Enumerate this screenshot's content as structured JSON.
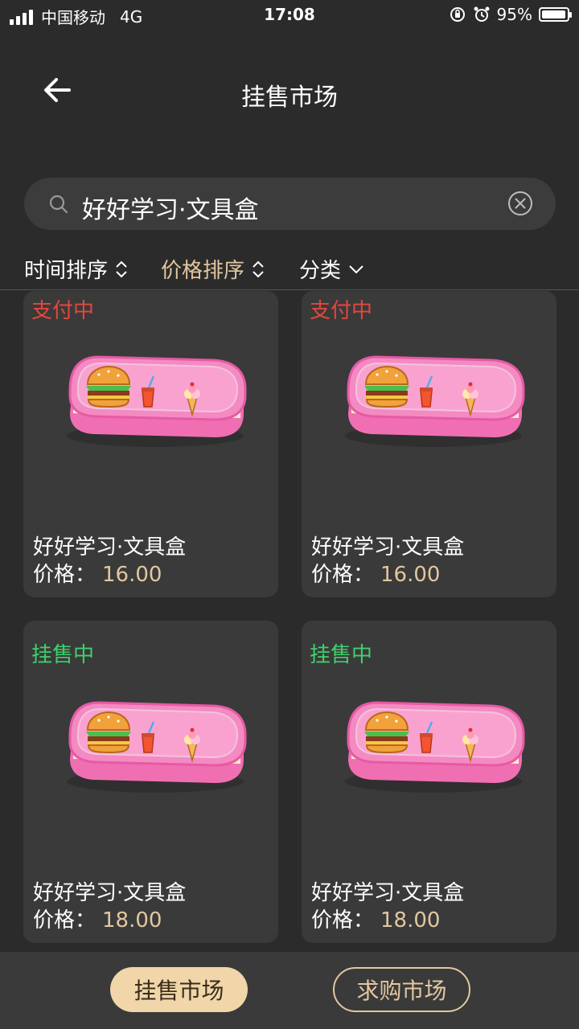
{
  "status_bar": {
    "carrier": "中国移动",
    "network": "4G",
    "time": "17:08",
    "battery": "95%",
    "battery_level": 0.95
  },
  "nav": {
    "title": "挂售市场",
    "back_icon": "arrow-left-icon"
  },
  "search": {
    "value": "好好学习·文具盒",
    "icon": "search-icon",
    "clear_icon": "clear-circle-icon"
  },
  "filters": {
    "time_sort": "时间排序",
    "price_sort": "价格排序",
    "category": "分类"
  },
  "colors": {
    "background": "#2b2b2b",
    "card": "#3a3a3a",
    "accent": "#e2c7a0",
    "paying": "#e2483d",
    "selling": "#3fd06b"
  },
  "price_label": "价格：",
  "items": [
    {
      "status": "支付中",
      "name": "好好学习·文具盒",
      "price": "16.00"
    },
    {
      "status": "支付中",
      "name": "好好学习·文具盒",
      "price": "16.00"
    },
    {
      "status": "挂售中",
      "name": "好好学习·文具盒",
      "price": "18.00"
    },
    {
      "status": "挂售中",
      "name": "好好学习·文具盒",
      "price": "18.00"
    }
  ],
  "bottom_tabs": {
    "sell_market": "挂售市场",
    "buy_market": "求购市场"
  }
}
